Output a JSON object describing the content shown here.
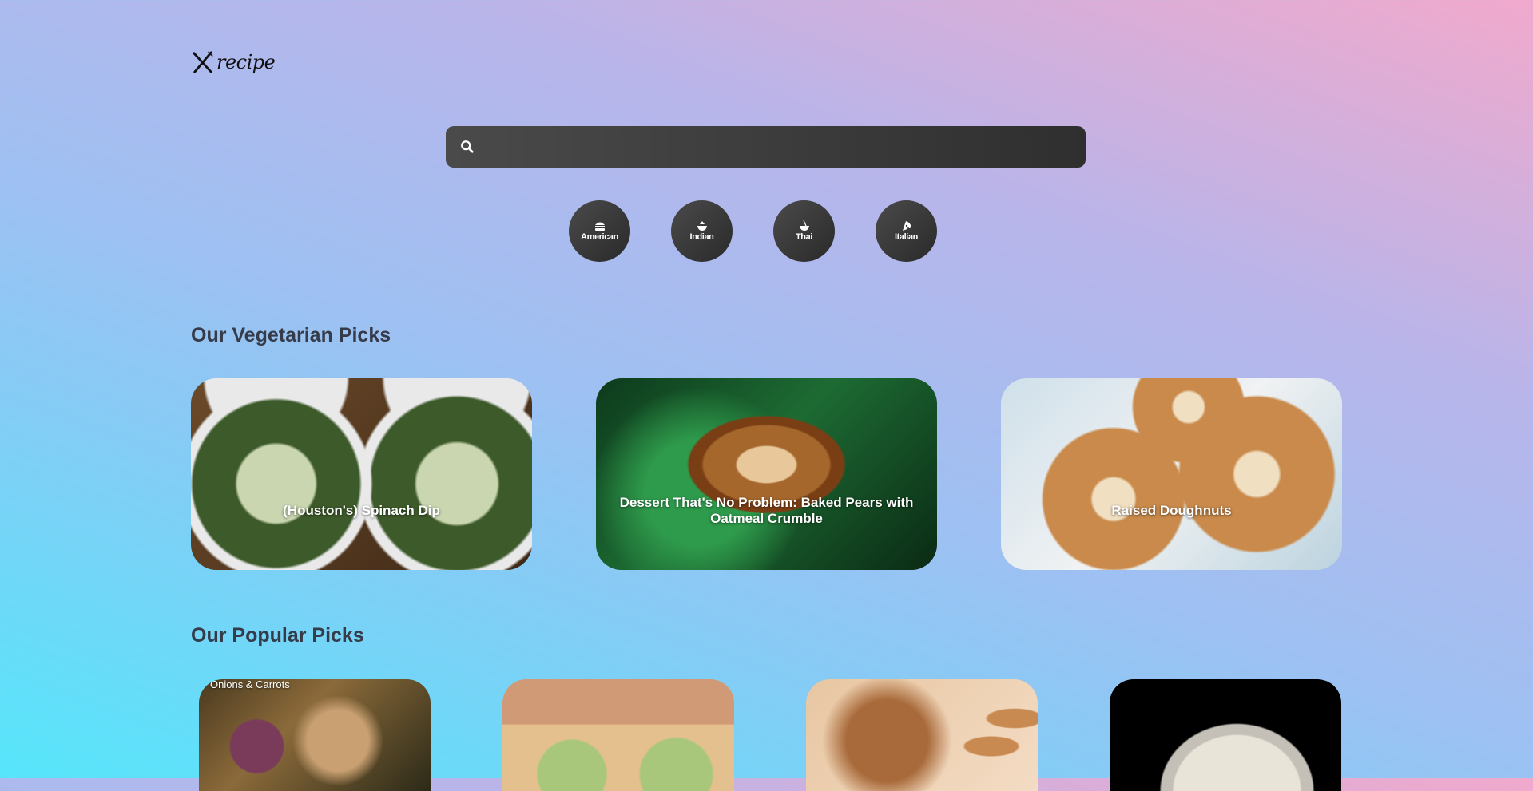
{
  "brand": {
    "name": "recipe"
  },
  "search": {
    "value": "",
    "placeholder": ""
  },
  "cuisines": [
    {
      "label": "American",
      "icon": "hamburger-icon"
    },
    {
      "label": "Indian",
      "icon": "curry-pot-icon"
    },
    {
      "label": "Thai",
      "icon": "noodle-bowl-icon"
    },
    {
      "label": "Italian",
      "icon": "pizza-icon"
    }
  ],
  "vegetarian": {
    "title": "Our Vegetarian Picks",
    "items": [
      {
        "title": "(Houston's) Spinach Dip"
      },
      {
        "title": "Dessert That's No Problem: Baked Pears with Oatmeal Crumble"
      },
      {
        "title": "Raised Doughnuts"
      }
    ]
  },
  "popular": {
    "title": "Our Popular Picks",
    "items": [
      {
        "title": "Onions & Carrots"
      },
      {
        "title": ""
      },
      {
        "title": ""
      },
      {
        "title": ""
      }
    ]
  }
}
